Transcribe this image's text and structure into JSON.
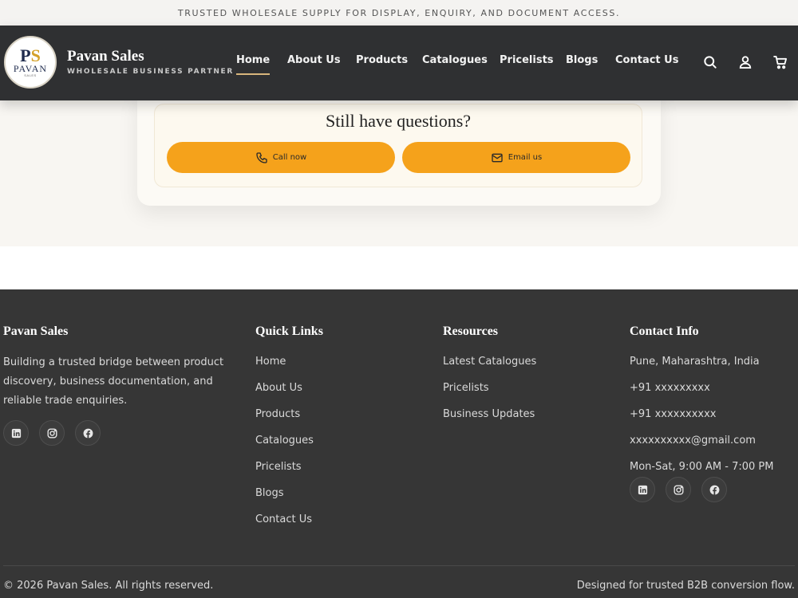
{
  "topbar": {
    "text": "TRUSTED WHOLESALE SUPPLY FOR DISPLAY, ENQUIRY, AND DOCUMENT ACCESS."
  },
  "header": {
    "logo": {
      "monogram_p": "P",
      "monogram_s": "S",
      "word": "PAVAN",
      "sub": "SALES"
    },
    "brand_name": "Pavan Sales",
    "brand_tagline": "WHOLESALE BUSINESS PARTNER",
    "nav": [
      "Home",
      "About Us",
      "Products",
      "Catalogues",
      "Pricelists",
      "Blogs",
      "Contact Us"
    ],
    "active_nav": "Home",
    "icons": [
      "search-icon",
      "user-icon",
      "cart-icon"
    ]
  },
  "faq": {
    "title": "Still have questions?",
    "call_label": "Call now",
    "email_label": "Email us",
    "accent": "#f5a21b"
  },
  "footer": {
    "brand": {
      "title": "Pavan Sales",
      "description": "Building a trusted bridge between product discovery, business documentation, and reliable trade enquiries.",
      "socials": [
        "linkedin-icon",
        "instagram-icon",
        "facebook-icon"
      ]
    },
    "quick_links": {
      "title": "Quick Links",
      "items": [
        "Home",
        "About Us",
        "Products",
        "Catalogues",
        "Pricelists",
        "Blogs",
        "Contact Us"
      ]
    },
    "resources": {
      "title": "Resources",
      "items": [
        "Latest Catalogues",
        "Pricelists",
        "Business Updates"
      ]
    },
    "contact": {
      "title": "Contact Info",
      "address": "Pune, Maharashtra, India",
      "phone1": "+91 xxxxxxxxx",
      "phone2": "+91 xxxxxxxxxx",
      "email": "xxxxxxxxxx@gmail.com",
      "hours": "Mon-Sat, 9:00 AM - 7:00 PM",
      "socials": [
        "linkedin-icon",
        "instagram-icon",
        "facebook-icon"
      ]
    },
    "copyright": "© 2026 Pavan Sales. All rights reserved.",
    "credit": "Designed for trusted B2B conversion flow."
  }
}
